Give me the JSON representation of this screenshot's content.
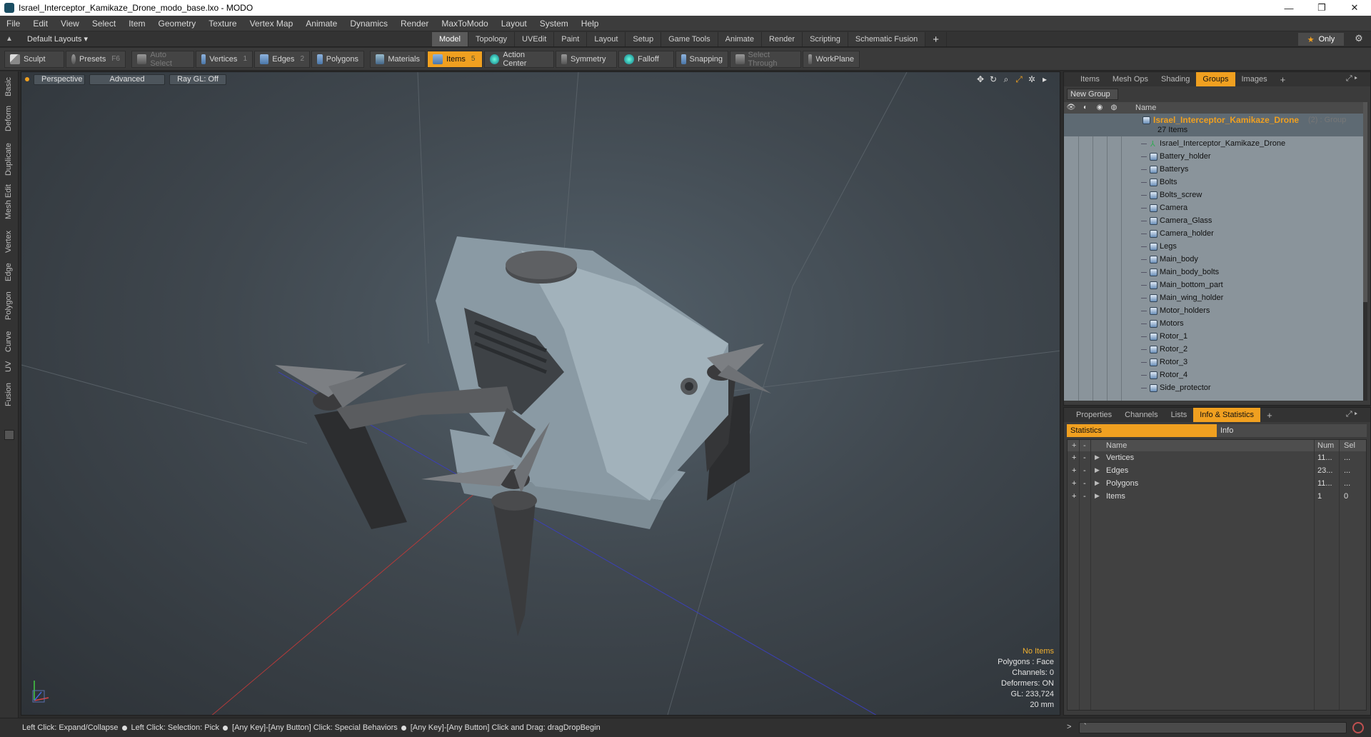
{
  "window": {
    "title": "Israel_Interceptor_Kamikaze_Drone_modo_base.lxo - MODO",
    "app_icon": "MODO",
    "controls": [
      "—",
      "❐",
      "✕"
    ]
  },
  "menu": [
    "File",
    "Edit",
    "View",
    "Select",
    "Item",
    "Geometry",
    "Texture",
    "Vertex Map",
    "Animate",
    "Dynamics",
    "Render",
    "MaxToModo",
    "Layout",
    "System",
    "Help"
  ],
  "layoutbar": {
    "layout_label": "Default Layouts ▾",
    "tabs": [
      "Model",
      "Topology",
      "UVEdit",
      "Paint",
      "Layout",
      "Setup",
      "Game Tools",
      "Animate",
      "Render",
      "Scripting",
      "Schematic Fusion"
    ],
    "active_tab": "Model",
    "add_tab": "+",
    "only_label": "Only"
  },
  "toolbar": {
    "sculpt": "Sculpt",
    "presets": "Presets",
    "presets_key": "F6",
    "auto_select": "Auto Select",
    "vertices": "Vertices",
    "vertices_count": "1",
    "edges": "Edges",
    "edges_count": "2",
    "polygons": "Polygons",
    "materials": "Materials",
    "items": "Items",
    "items_count": "5",
    "action_center": "Action Center",
    "symmetry": "Symmetry",
    "falloff": "Falloff",
    "snapping": "Snapping",
    "select_through": "Select Through",
    "workplane": "WorkPlane"
  },
  "left_tabs": [
    "Basic",
    "Deform",
    "Duplicate",
    "Mesh Edit",
    "Vertex",
    "Edge",
    "Polygon",
    "Curve",
    "UV",
    "Fusion"
  ],
  "viewport": {
    "perspective": "Perspective",
    "advanced": "Advanced",
    "raygl": "Ray GL: Off",
    "info": {
      "no_items": "No Items",
      "polygons": "Polygons : Face",
      "channels": "Channels: 0",
      "deformers": "Deformers: ON",
      "gl": "GL: 233,724",
      "scale": "20 mm"
    }
  },
  "groups_panel": {
    "tabs": [
      "Items",
      "Mesh Ops",
      "Shading",
      "Groups",
      "Images"
    ],
    "active_tab": "Groups",
    "new_group": "New Group",
    "col_name": "Name",
    "group_name": "Israel_Interceptor_Kamikaze_Drone",
    "group_suffix": "(2) : Group",
    "group_count": "27 Items",
    "items": [
      "Israel_Interceptor_Kamikaze_Drone",
      "Battery_holder",
      "Batterys",
      "Bolts",
      "Bolts_screw",
      "Camera",
      "Camera_Glass",
      "Camera_holder",
      "Legs",
      "Main_body",
      "Main_body_bolts",
      "Main_bottom_part",
      "Main_wing_holder",
      "Motor_holders",
      "Motors",
      "Rotor_1",
      "Rotor_2",
      "Rotor_3",
      "Rotor_4",
      "Side_protector"
    ]
  },
  "info_panel": {
    "tabs": [
      "Properties",
      "Channels",
      "Lists",
      "Info & Statistics"
    ],
    "active_tab": "Info & Statistics",
    "statistics": "Statistics",
    "info": "Info",
    "col_name": "Name",
    "col_num": "Num",
    "col_sel": "Sel",
    "rows": [
      {
        "name": "Vertices",
        "num": "11...",
        "sel": "..."
      },
      {
        "name": "Edges",
        "num": "23...",
        "sel": "..."
      },
      {
        "name": "Polygons",
        "num": "11...",
        "sel": "..."
      },
      {
        "name": "Items",
        "num": "1",
        "sel": "0"
      }
    ]
  },
  "statusbar": {
    "s1": "Left Click: Expand/Collapse",
    "s2": "Left Click: Selection: Pick",
    "s3": "[Any Key]-[Any Button] Click: Special Behaviors",
    "s4": "[Any Key]-[Any Button] Click and Drag: dragDropBegin"
  },
  "command": {
    "prompt": ">",
    "value": "`"
  },
  "colors": {
    "accent": "#f0a020",
    "panel_bg": "#3b3b3b",
    "grid_bg": "#8a949b",
    "viewport_bg": "#45505a"
  }
}
